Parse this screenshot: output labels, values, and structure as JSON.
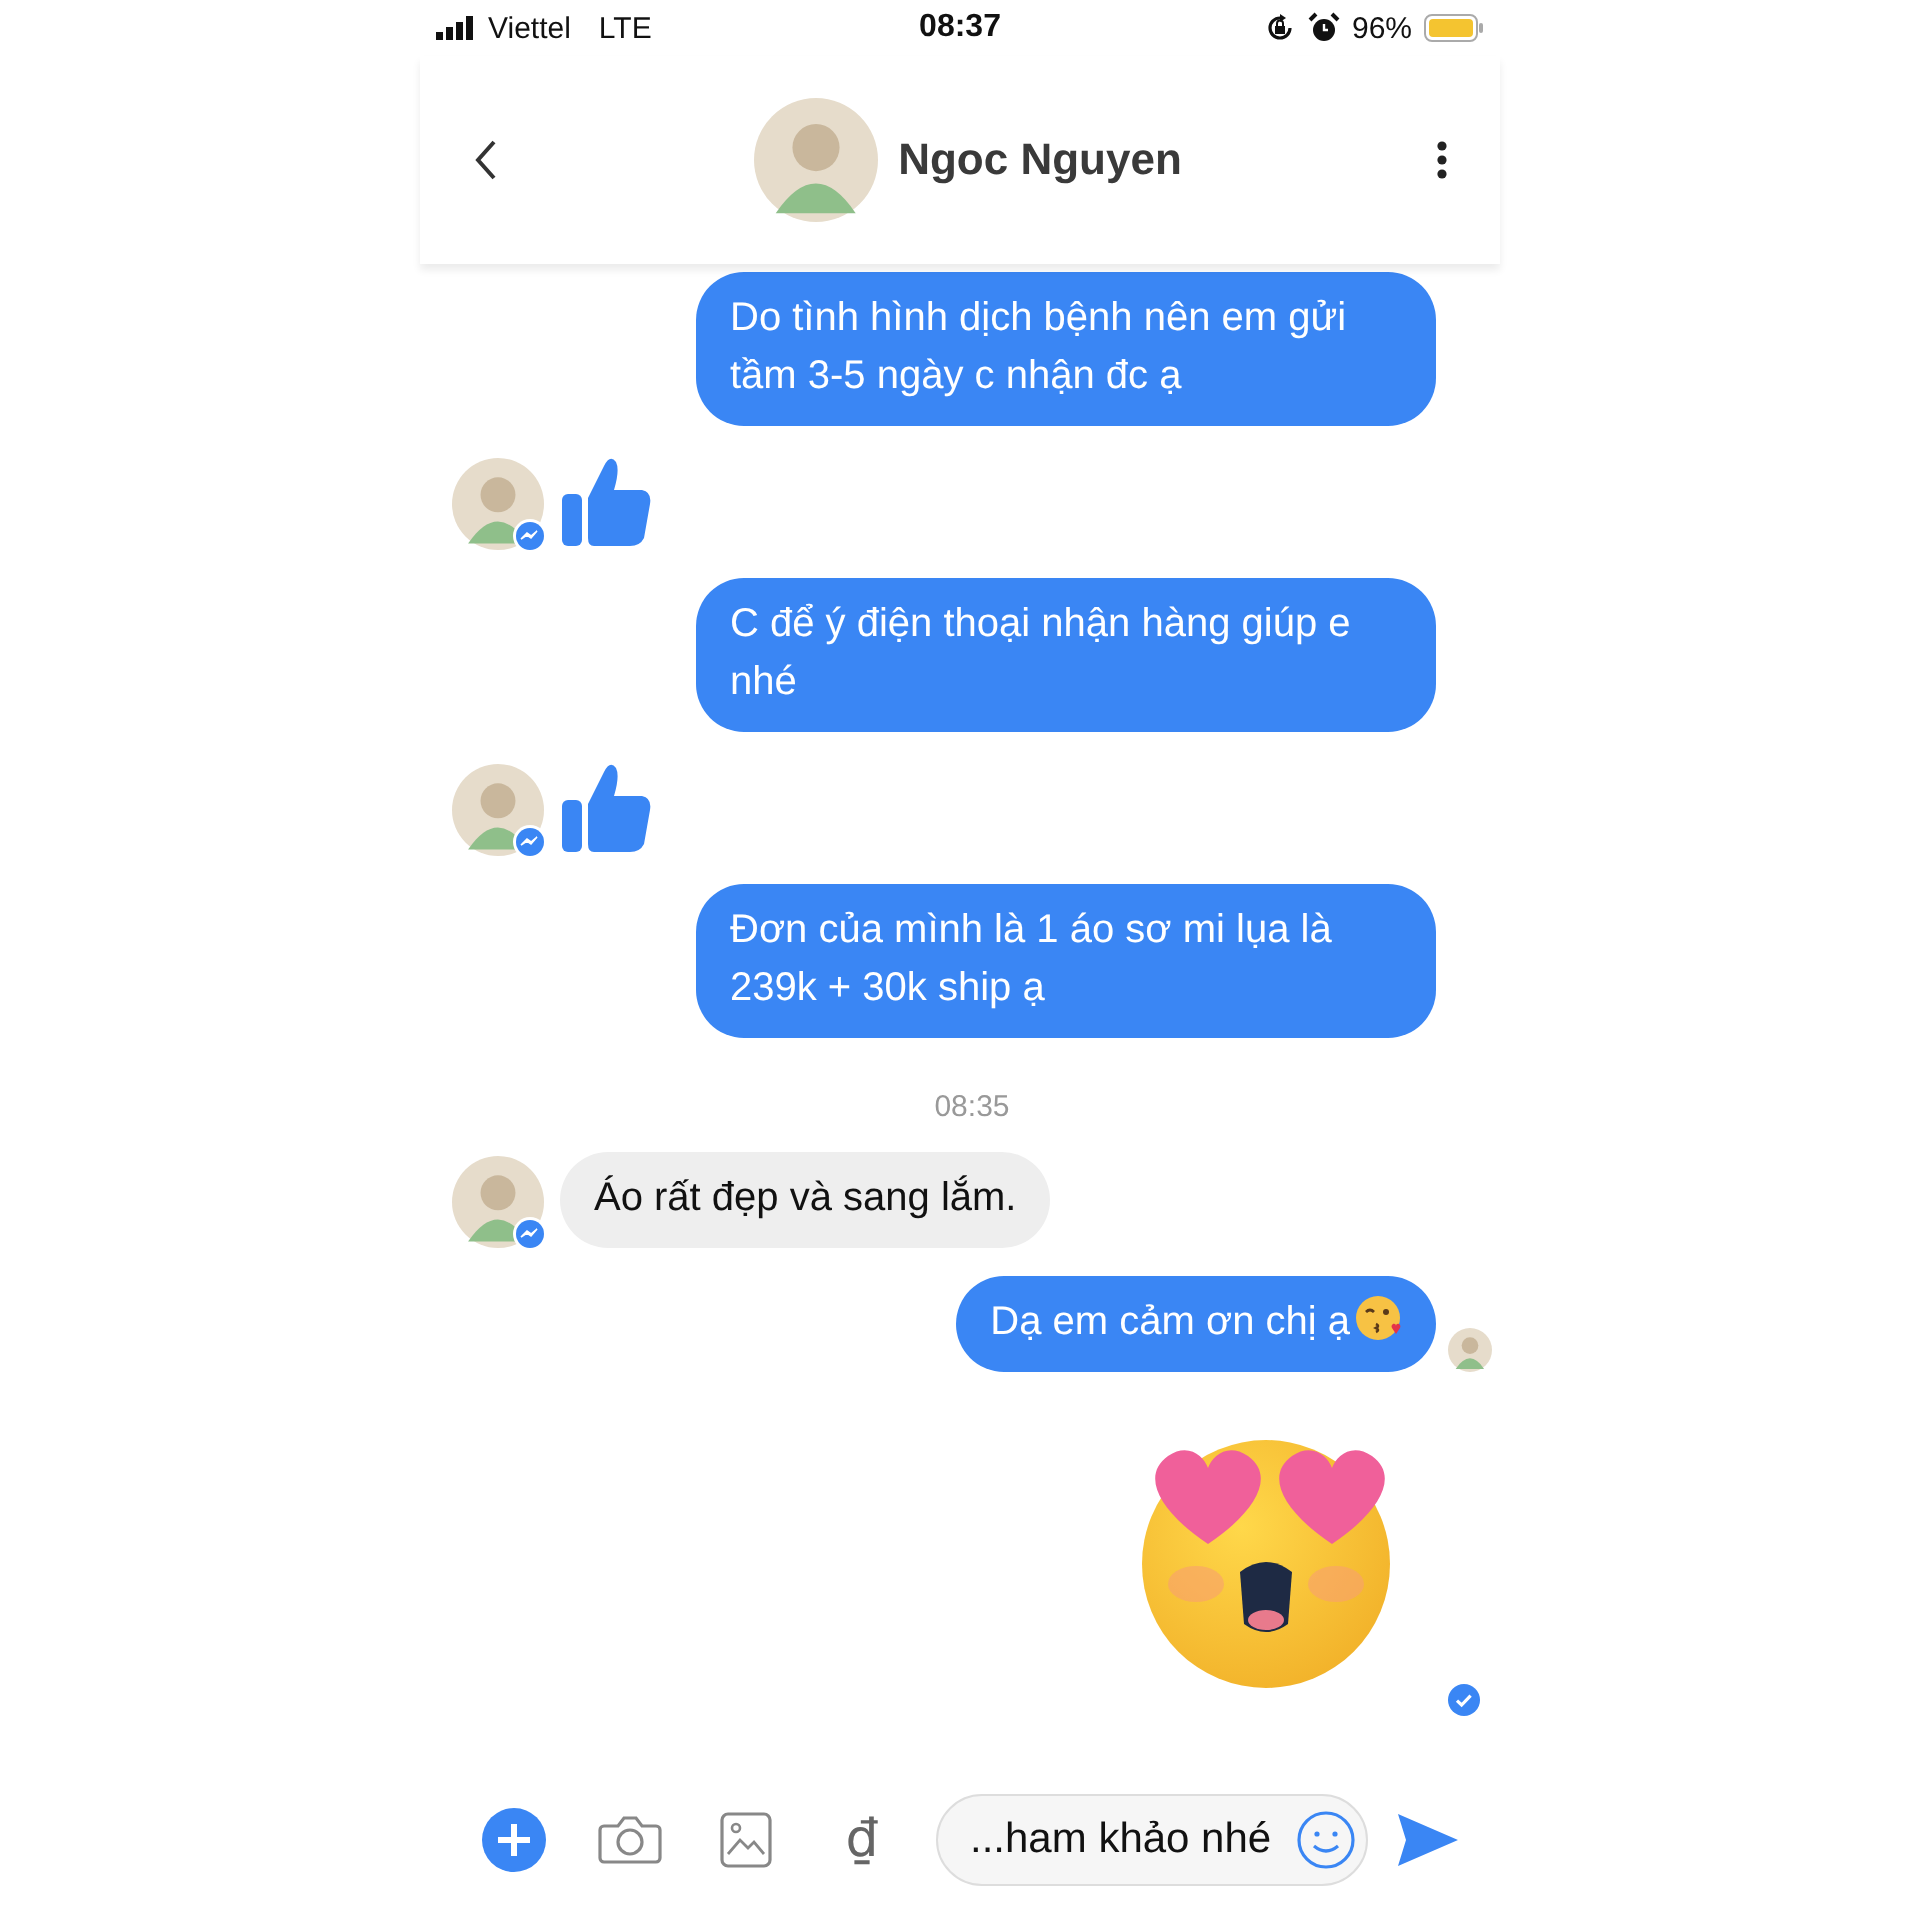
{
  "status_bar": {
    "carrier": "Viettel",
    "network": "LTE",
    "time": "08:37",
    "battery": "96%"
  },
  "header": {
    "title": "Ngoc Nguyen"
  },
  "messages": [
    {
      "kind": "outgoing",
      "text": "Do tình hình dịch bệnh nên em gửi tầm 3-5 ngày c nhận đc ạ"
    },
    {
      "kind": "like"
    },
    {
      "kind": "outgoing",
      "text": "C để ý điện thoại nhận hàng giúp e nhé"
    },
    {
      "kind": "like"
    },
    {
      "kind": "outgoing",
      "text": "Đơn của mình là 1 áo sơ mi lụa là 239k + 30k ship ạ"
    },
    {
      "kind": "timestamp",
      "text": "08:35"
    },
    {
      "kind": "incoming",
      "text": "Áo rất đẹp và sang lắm."
    },
    {
      "kind": "outgoing",
      "text": "Dạ em cảm ơn chị ạ",
      "emoji": {
        "kind": "kiss"
      },
      "seen": true
    },
    {
      "kind": "sticker",
      "sent": true
    }
  ],
  "composer": {
    "currency": "₫",
    "value": "...ham khảo nhé"
  }
}
